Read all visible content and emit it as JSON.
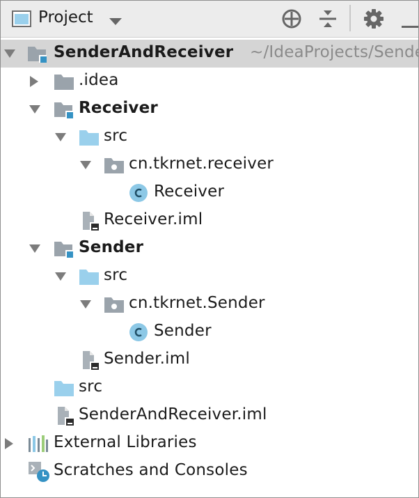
{
  "panel": {
    "title": "Project",
    "colors": {
      "folder_blue": "#9ad0ec",
      "folder_gray": "#9aa3ab",
      "module_badge": "#3592c4",
      "class_icon": "#8cc8e6",
      "selection": "#d5d5d5"
    },
    "toolbar_icons": [
      "project-view-icon",
      "dropdown-icon",
      "locate-icon",
      "collapse-all-icon",
      "gear-icon",
      "hide-icon"
    ]
  },
  "tree": {
    "root": {
      "label": "SenderAndReceiver",
      "path": "~/IdeaProjects/SenderAndReceiver"
    },
    "idea": {
      "label": ".idea"
    },
    "receiver": {
      "label": "Receiver",
      "src": "src",
      "package": "cn.tkrnet.receiver",
      "class": "Receiver",
      "iml": "Receiver.iml"
    },
    "sender": {
      "label": "Sender",
      "src": "src",
      "package": "cn.tkrnet.Sender",
      "class": "Sender",
      "iml": "Sender.iml"
    },
    "root_src": "src",
    "root_iml": "SenderAndReceiver.iml",
    "external_libraries": "External Libraries",
    "scratches": "Scratches and Consoles"
  }
}
